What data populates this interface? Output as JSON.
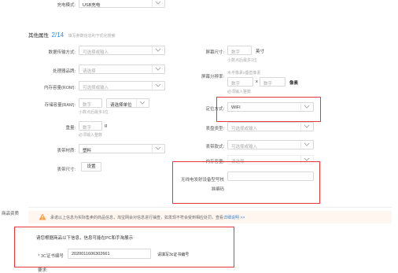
{
  "charge": {
    "label": "充电模式:",
    "value": "USB充电"
  },
  "other_attrs": {
    "title": "其他属性",
    "count": "2/14",
    "subtitle": "填写参数信息利于优化搜索"
  },
  "left_fields": {
    "data_transfer": {
      "label": "数据传输方式:",
      "placeholder": "可选择或输入"
    },
    "processor": {
      "label": "处理器品牌:",
      "placeholder": "请选择"
    },
    "rom": {
      "label": "内存容量(ROM):",
      "placeholder": "可选择或输入"
    },
    "ram": {
      "label": "存储容量(RAM):",
      "placeholder": "数字",
      "unit_placeholder": "请选择单位",
      "hint": "小数点后最多1位"
    },
    "weight": {
      "label": "重量:",
      "placeholder": "数字",
      "unit": "g",
      "hint": "必须输入整数"
    },
    "material": {
      "label": "表带材质:",
      "value": "塑料"
    },
    "size": {
      "label": "表带尺寸:",
      "button": "设置"
    }
  },
  "right_fields": {
    "screen_size": {
      "label": "屏幕尺寸:",
      "placeholder": "数字",
      "unit": "英寸",
      "hint": "小数点后最多1位"
    },
    "resolution": {
      "label": "屏幕分辨率:",
      "hint_top": "水平像素x垂直像素",
      "placeholder_a": "数字",
      "x": "x",
      "placeholder_b": "数字",
      "unit": "像素",
      "hint": "必须输入整数"
    },
    "positioning": {
      "label": "定位方式:",
      "value": "WIFI"
    },
    "dial_shape": {
      "label": "表盘类型:",
      "placeholder": "可选择或输入"
    },
    "watch_style": {
      "label": "表带款式:",
      "placeholder": "可选择或输入"
    },
    "memory": {
      "label": "内存容量:",
      "placeholder": "请选择"
    },
    "wireless_model": {
      "label_line1": "无线电发射设备型号核",
      "label_line2": "准编码"
    }
  },
  "product_qual": {
    "section_label": "商品资质"
  },
  "warning": {
    "text": "承诺以上信息为实际售卖的商品信息，淘宝网会对信息进行抽查，如发现不符会受到相应处罚，查看",
    "link": "详细说明 >>"
  },
  "ccc": {
    "note": "请您根据商品以下信息，信息可能在PC和手淘展示",
    "label": "* 3C证书编号",
    "value": "2020011606302661",
    "hint": "请填写3c证书编号"
  },
  "bottom": {
    "label": "要求:"
  },
  "colors": {
    "accent_red": "#e4393c",
    "warning_bg": "#fff6f0",
    "warning_icon": "#ff9c3c",
    "link": "#3089dc"
  }
}
